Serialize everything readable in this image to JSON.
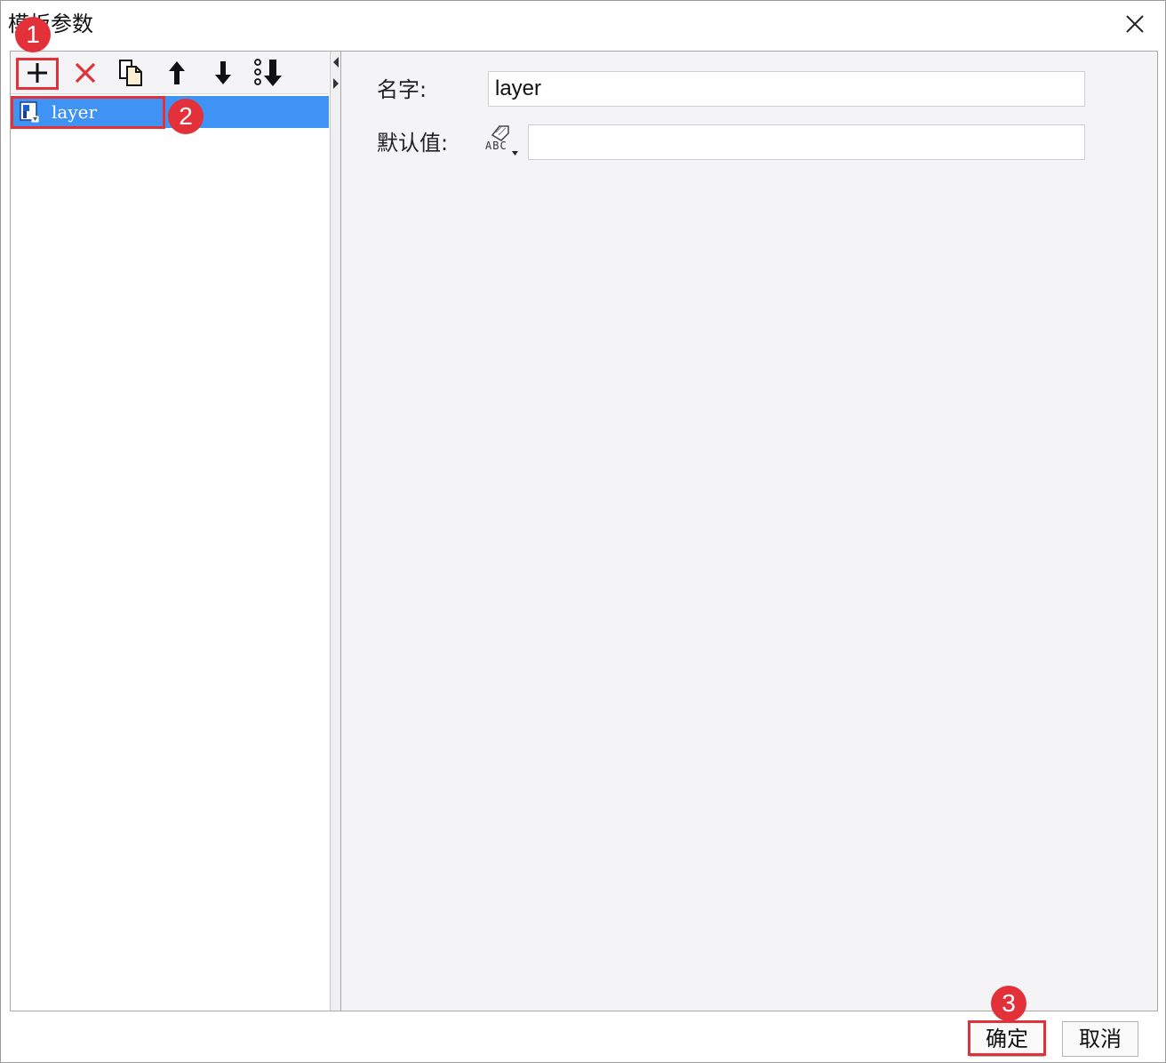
{
  "window": {
    "title": "模板参数",
    "close_icon": "close-icon"
  },
  "toolbar": {
    "buttons": [
      {
        "name": "add-icon"
      },
      {
        "name": "delete-icon",
        "color": "#e3313a"
      },
      {
        "name": "copy-icon"
      },
      {
        "name": "move-up-icon"
      },
      {
        "name": "move-down-icon"
      },
      {
        "name": "move-bottom-icon"
      }
    ]
  },
  "parameter_list": {
    "items": [
      {
        "label": "layer",
        "selected": true,
        "icon": "parameter-icon"
      }
    ],
    "selected_color": "#3f93f5"
  },
  "form": {
    "name_label": "名字:",
    "name_value": "layer",
    "default_label": "默认值:",
    "default_value": "",
    "type_selector_text": "ABC",
    "type_selector_icon": "formula-type-icon"
  },
  "buttons": {
    "ok_label": "确定",
    "cancel_label": "取消"
  },
  "annotations": {
    "color": "#e3313a",
    "markers": [
      "1",
      "2",
      "3"
    ]
  }
}
